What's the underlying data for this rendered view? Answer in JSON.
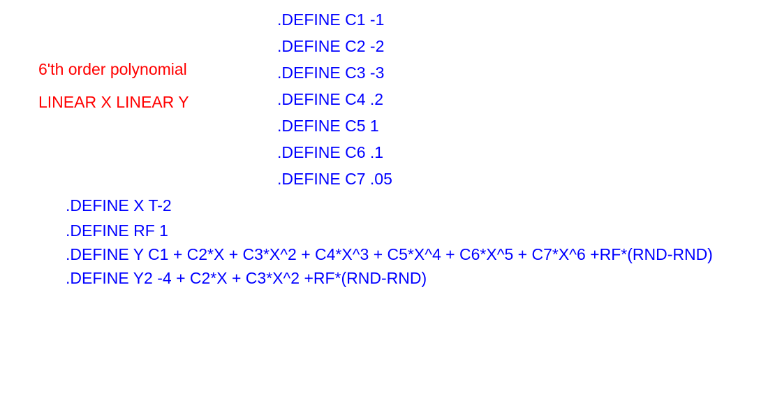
{
  "titles": {
    "line1": "6'th order polynomial",
    "line2": "LINEAR X LINEAR Y"
  },
  "defines": {
    "c1": ".DEFINE C1 -1",
    "c2": ".DEFINE C2 -2",
    "c3": ".DEFINE C3 -3",
    "c4": ".DEFINE C4 .2",
    "c5": ".DEFINE C5 1",
    "c6": ".DEFINE C6 .1",
    "c7": ".DEFINE C7 .05",
    "x": ".DEFINE X T-2",
    "rf": ".DEFINE RF 1",
    "y": ".DEFINE Y C1 + C2*X + C3*X^2 + C4*X^3 + C5*X^4 + C6*X^5 + C7*X^6 +RF*(RND-RND)",
    "y2": ".DEFINE Y2 -4 + C2*X + C3*X^2 +RF*(RND-RND)"
  }
}
